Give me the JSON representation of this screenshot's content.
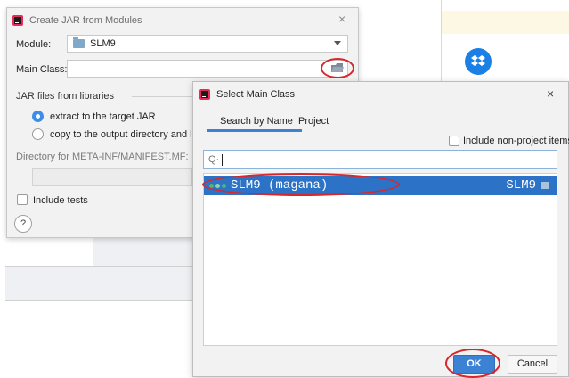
{
  "dialog1": {
    "title": "Create JAR from Modules",
    "module_label": "Module:",
    "module_value": "SLM9",
    "main_class_label": "Main Class:",
    "main_class_value": "",
    "libraries_group_label": "JAR files from libraries",
    "option_extract": "extract to the target JAR",
    "option_copy": "copy to the output directory and link vi",
    "manifest_label": "Directory for META-INF/MANIFEST.MF:",
    "manifest_value": "",
    "include_tests": "Include tests",
    "help_glyph": "?",
    "close_glyph": "×",
    "selected_option": "extract"
  },
  "dialog2": {
    "title": "Select Main Class",
    "close_glyph": "×",
    "tabs": [
      {
        "label": "Search by Name",
        "active": true
      },
      {
        "label": "Project",
        "active": false
      }
    ],
    "include_non_project": "Include non-project items",
    "search_glyph": "Q·",
    "search_value": "",
    "results": [
      {
        "name": "SLM9 (magana)",
        "module": "SLM9",
        "selected": true
      }
    ],
    "ok_label": "OK",
    "cancel_label": "Cancel"
  },
  "icons": [
    "app-logo-icon",
    "folder-icon",
    "browse-folder-icon",
    "search-icon",
    "class-icon",
    "module-folder-icon",
    "dropbox-icon"
  ],
  "colors": {
    "accent": "#3c82d4",
    "selection": "#2c72c6",
    "annotation": "#d9262c",
    "dropbox": "#1a80e6"
  }
}
